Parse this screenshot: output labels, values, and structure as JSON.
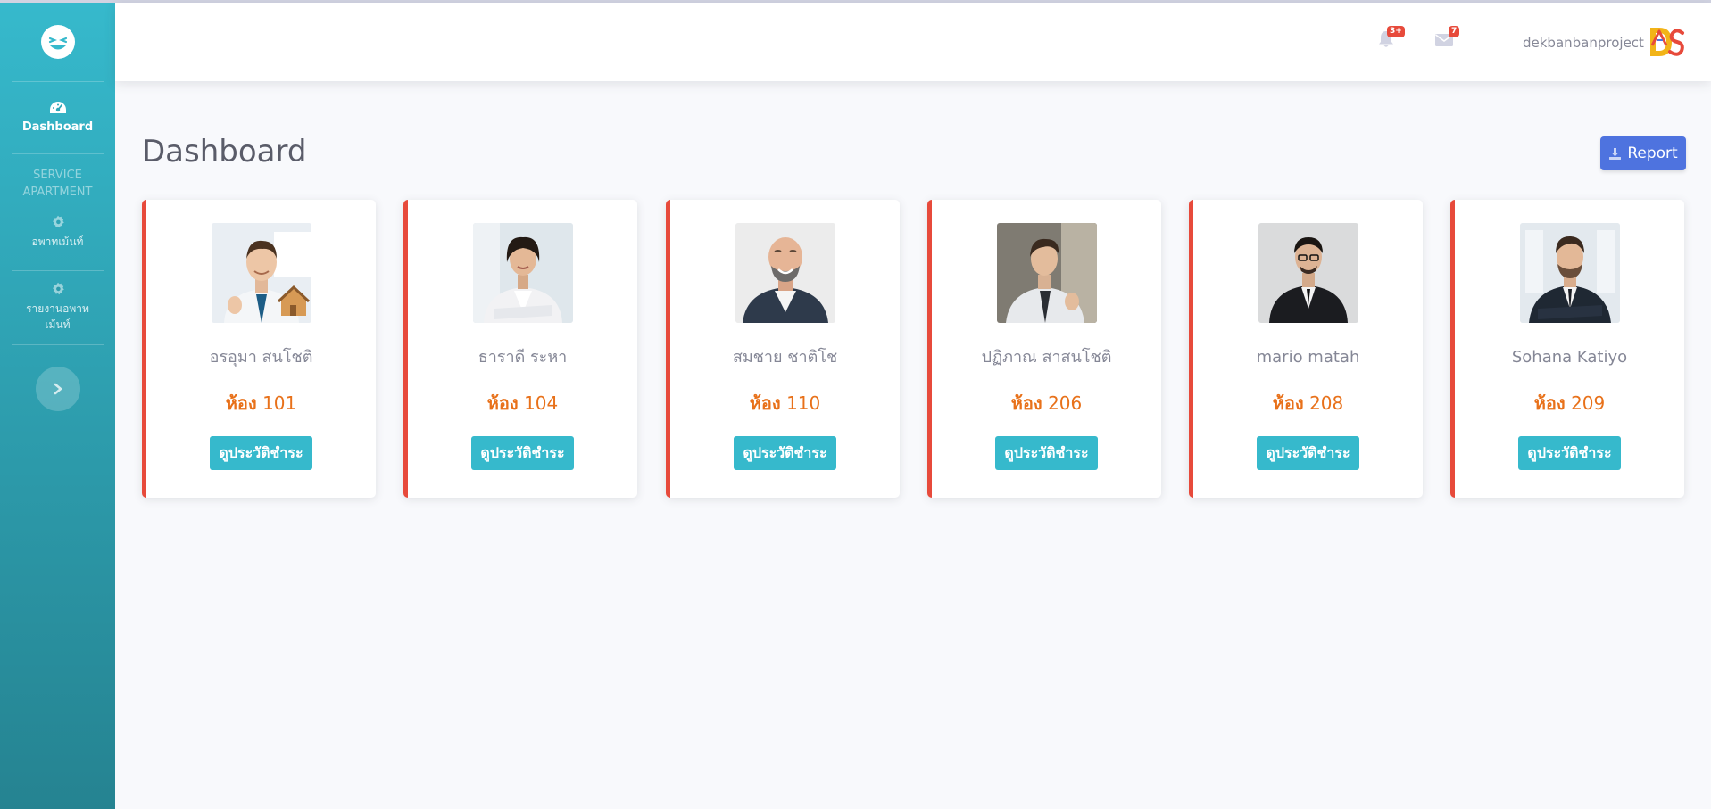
{
  "sidebar": {
    "brand_icon": "laughing-face-icon",
    "dashboard_label": "Dashboard",
    "dashboard_icon": "tachometer-icon",
    "section_heading": "SERVICE APARTMENT",
    "apartment_label": "อพาทเม้นท์",
    "apartment_icon": "gear-icon",
    "report_label": "รายงานอพาทเม้นท์",
    "report_icon": "gear-icon",
    "toggle_icon": "chevron-right-icon"
  },
  "topbar": {
    "alerts_badge": "3+",
    "messages_badge": "7",
    "username": "dekbanbanproject",
    "alerts_icon": "bell-icon",
    "messages_icon": "envelope-icon",
    "logo_icon": "ds-logo-icon"
  },
  "page": {
    "title": "Dashboard",
    "report_label": "Report",
    "report_icon": "download-icon"
  },
  "room_prefix": "ห้อง",
  "history_label": "ดูประวัติชำระ",
  "tenants": [
    {
      "name": "อรอุมา สนโชติ",
      "room": "101",
      "photo": "tenant-photo"
    },
    {
      "name": "ธาราดี ระหา",
      "room": "104",
      "photo": "tenant-photo"
    },
    {
      "name": "สมชาย ชาติโช",
      "room": "110",
      "photo": "tenant-photo"
    },
    {
      "name": "ปฏิภาณ สาสนโชติ",
      "room": "206",
      "photo": "tenant-photo"
    },
    {
      "name": "mario matah",
      "room": "208",
      "photo": "tenant-photo"
    },
    {
      "name": "Sohana Katiyo",
      "room": "209",
      "photo": "tenant-photo"
    }
  ],
  "colors": {
    "sidebar_top": "#36b9cc",
    "sidebar_bottom": "#258391",
    "card_border": "#e74a3b",
    "room_text": "#e8711a",
    "history_button": "#36b9cc",
    "report_button": "#4e73df",
    "badge": "#e74a3b"
  }
}
